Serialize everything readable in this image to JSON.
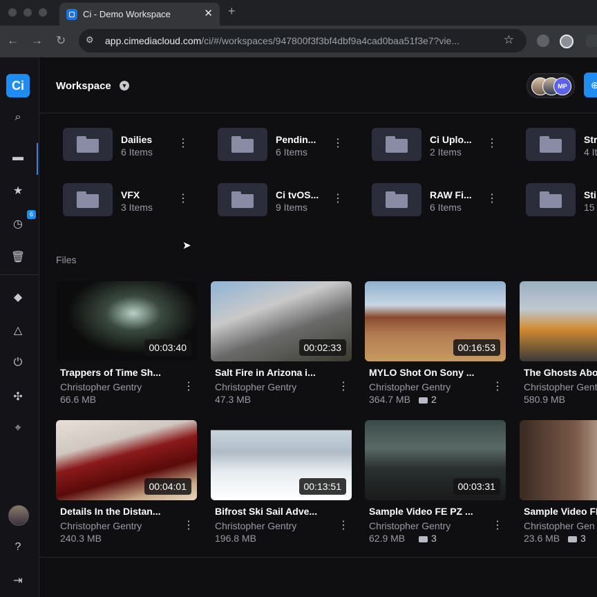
{
  "browser": {
    "tab_title": "Ci - Demo Workspace",
    "url_host": "app.cimediacloud.com",
    "url_path": "/ci/#/workspaces/947800f3f3bf4dbf9a4cad0baa51f3e7?vie..."
  },
  "sidebar": {
    "logo": "Ci",
    "items": [
      "search-icon",
      "folder-icon",
      "star-icon",
      "clock-icon",
      "trash-icon",
      "cube-icon",
      "triangle-icon",
      "download-icon",
      "hub-icon",
      "target-icon"
    ],
    "recent_badge": "6",
    "bottom": [
      "avatar",
      "help-icon",
      "logout-icon"
    ]
  },
  "header": {
    "title": "Workspace",
    "collaborator_initials": "MP"
  },
  "folders": [
    {
      "name": "Dailies",
      "count": "6 Items"
    },
    {
      "name": "Pendin...",
      "count": "6 Items"
    },
    {
      "name": "Ci Uplo...",
      "count": "2 Items"
    },
    {
      "name": "Str",
      "count": "4 It"
    },
    {
      "name": "VFX",
      "count": "3 Items"
    },
    {
      "name": "Ci tvOS...",
      "count": "9 Items"
    },
    {
      "name": "RAW Fi...",
      "count": "6 Items"
    },
    {
      "name": "Sti",
      "count": "15"
    }
  ],
  "files_label": "Files",
  "files": [
    {
      "title": "Trappers of Time Sh...",
      "author": "Christopher Gentry",
      "size": "66.6 MB",
      "duration": "00:03:40",
      "comments": ""
    },
    {
      "title": "Salt Fire in Arizona i...",
      "author": "Christopher Gentry",
      "size": "47.3 MB",
      "duration": "00:02:33",
      "comments": ""
    },
    {
      "title": "MYLO Shot On Sony ...",
      "author": "Christopher Gentry",
      "size": "364.7 MB",
      "duration": "00:16:53",
      "comments": "2"
    },
    {
      "title": "The Ghosts Abov",
      "author": "Christopher Gentry",
      "size": "580.9 MB",
      "duration": "",
      "comments": ""
    },
    {
      "title": "Details In the Distan...",
      "author": "Christopher Gentry",
      "size": "240.3 MB",
      "duration": "00:04:01",
      "comments": ""
    },
    {
      "title": "Bifrost Ski Sail Adve...",
      "author": "Christopher Gentry",
      "size": "196.8 MB",
      "duration": "00:13:51",
      "comments": ""
    },
    {
      "title": "Sample Video FE PZ ...",
      "author": "Christopher Gentry",
      "size": "62.9 MB",
      "duration": "00:03:31",
      "comments": "3"
    },
    {
      "title": "Sample Video FE",
      "author": "Christopher Gen",
      "size": "23.6 MB",
      "duration": "",
      "comments": "3"
    }
  ],
  "colors": {
    "accent": "#1e8cf0",
    "background": "#0f0f12",
    "sidebar": "#141418",
    "folder_tile": "#2c2d3a"
  }
}
